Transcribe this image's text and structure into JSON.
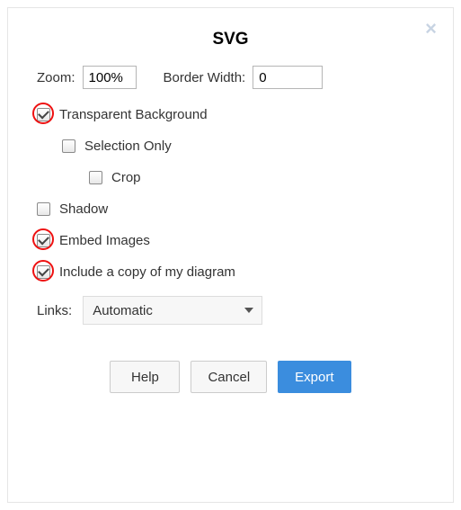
{
  "dialog": {
    "title": "SVG",
    "close_glyph": "×"
  },
  "fields": {
    "zoom_label": "Zoom:",
    "zoom_value": "100%",
    "border_label": "Border Width:",
    "border_value": "0"
  },
  "options": {
    "transparent": {
      "label": "Transparent Background",
      "checked": true,
      "highlight": true
    },
    "selection": {
      "label": "Selection Only",
      "checked": false,
      "highlight": false
    },
    "crop": {
      "label": "Crop",
      "checked": false,
      "highlight": false
    },
    "shadow": {
      "label": "Shadow",
      "checked": false,
      "highlight": false
    },
    "embed": {
      "label": "Embed Images",
      "checked": true,
      "highlight": true
    },
    "include": {
      "label": "Include a copy of my diagram",
      "checked": true,
      "highlight": true
    }
  },
  "links": {
    "label": "Links:",
    "value": "Automatic"
  },
  "buttons": {
    "help": "Help",
    "cancel": "Cancel",
    "export": "Export"
  }
}
